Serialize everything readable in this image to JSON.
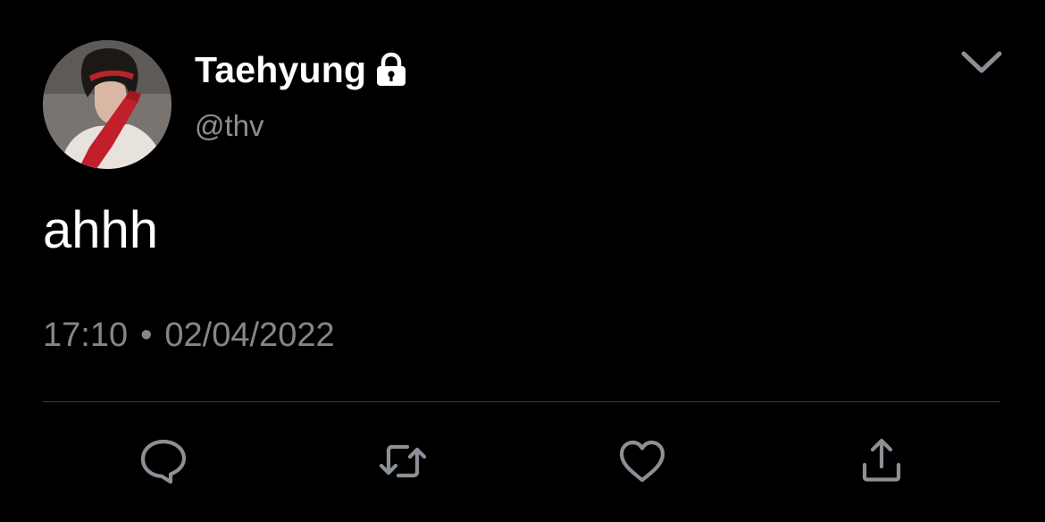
{
  "tweet": {
    "author": {
      "display_name": "Taehyung",
      "handle": "@thv",
      "protected_icon": "lock-icon",
      "avatar_icon": "profile-photo"
    },
    "menu_icon": "chevron-down-icon",
    "text": "ahhh",
    "time": "17:10",
    "separator": "•",
    "date": "02/04/2022",
    "actions": [
      {
        "name": "reply",
        "icon": "reply-icon"
      },
      {
        "name": "retweet",
        "icon": "retweet-icon"
      },
      {
        "name": "like",
        "icon": "heart-icon"
      },
      {
        "name": "share",
        "icon": "share-icon"
      }
    ]
  },
  "colors": {
    "background": "#000000",
    "primary_text": "#ffffff",
    "secondary_text": "#83878c",
    "icon": "#8b9096",
    "divider": "#3a3d42"
  }
}
